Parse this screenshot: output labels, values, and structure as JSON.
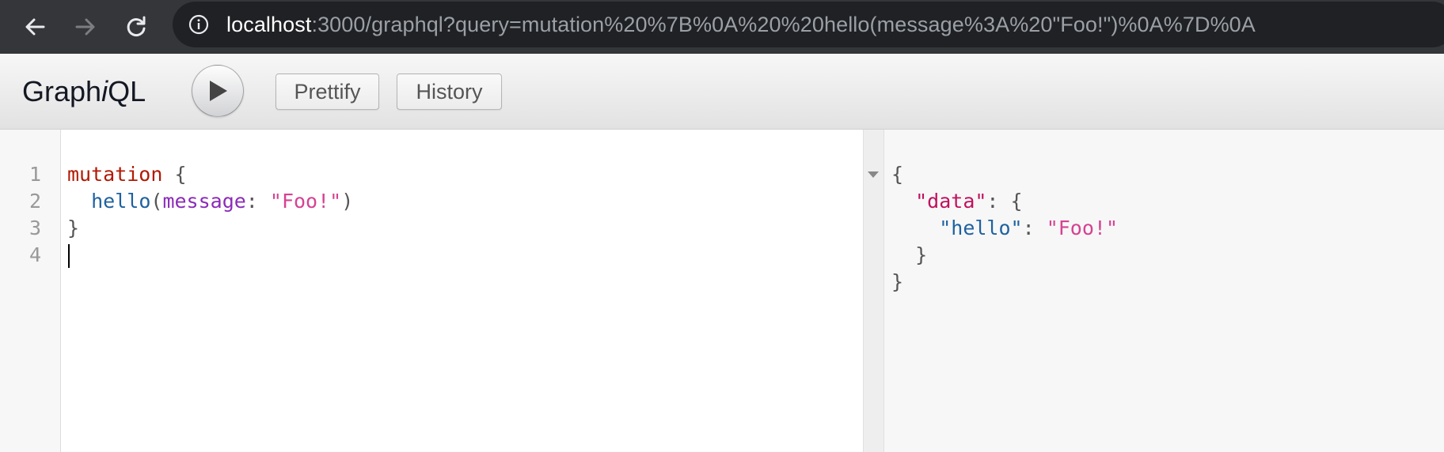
{
  "browser": {
    "url_host": "localhost",
    "url_rest": ":3000/graphql?query=mutation%20%7B%0A%20%20hello(message%3A%20\"Foo!\")%0A%7D%0A"
  },
  "toolbar": {
    "title_prefix": "Graph",
    "title_italic": "i",
    "title_suffix": "QL",
    "prettify_label": "Prettify",
    "history_label": "History"
  },
  "editor": {
    "line_numbers": [
      "1",
      "2",
      "3",
      "4"
    ],
    "line1_keyword": "mutation",
    "line1_brace": " {",
    "line2_indent": "  ",
    "line2_field": "hello",
    "line2_paren_open": "(",
    "line2_arg": "message",
    "line2_colon": ": ",
    "line2_value": "\"Foo!\"",
    "line2_paren_close": ")",
    "line3_brace": "}"
  },
  "result": {
    "open_brace": "{",
    "data_key": "\"data\"",
    "colon1": ": {",
    "hello_key": "\"hello\"",
    "colon2": ": ",
    "hello_value": "\"Foo!\"",
    "inner_close": "}",
    "outer_close": "}"
  }
}
